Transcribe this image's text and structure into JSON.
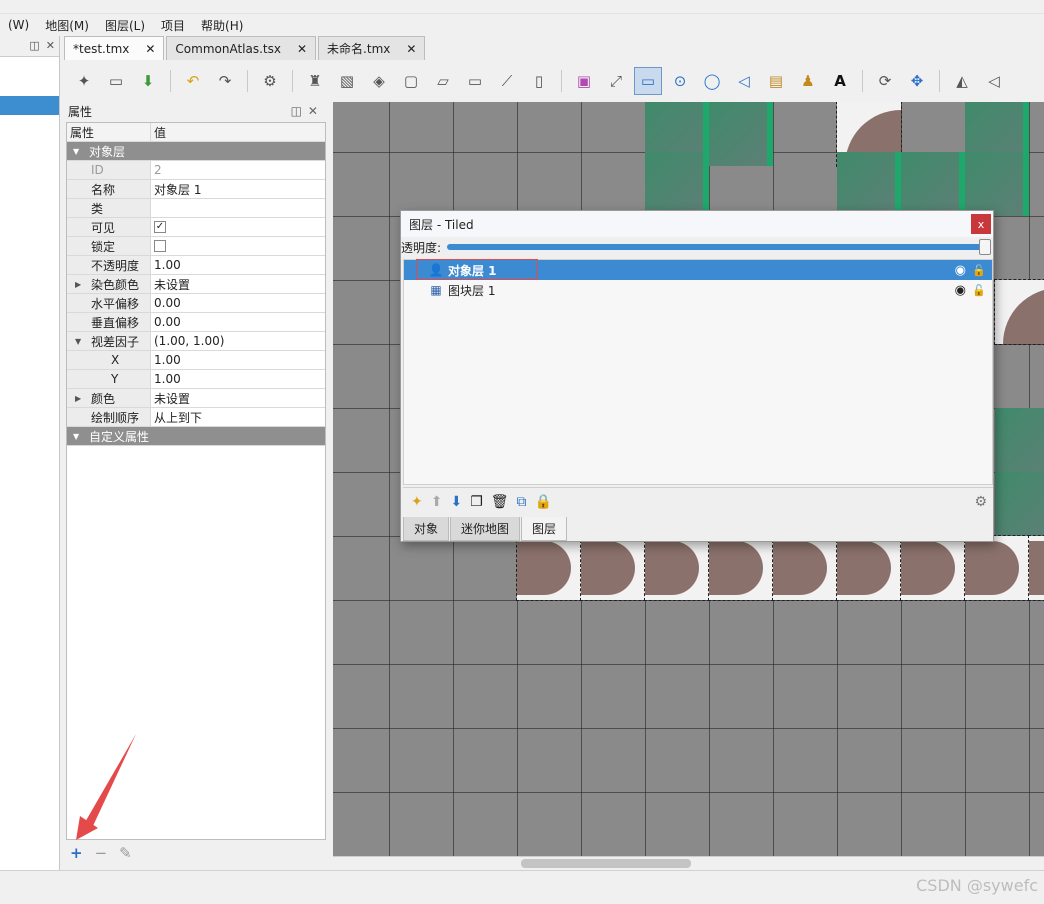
{
  "menu": {
    "items": [
      "(W)",
      "地图(M)",
      "图层(L)",
      "项目",
      "帮助(H)"
    ]
  },
  "tabs": [
    {
      "label": "*test.tmx",
      "close": "✕"
    },
    {
      "label": "CommonAtlas.tsx",
      "close": "✕"
    },
    {
      "label": "未命名.tmx",
      "close": "✕"
    }
  ],
  "properties_panel": {
    "title": "属性",
    "col_key": "属性",
    "col_value": "值",
    "group_object_layer": "对象层",
    "rows": [
      {
        "key": "ID",
        "value": "2"
      },
      {
        "key": "名称",
        "value": "对象层 1"
      },
      {
        "key": "类",
        "value": ""
      },
      {
        "key": "可见",
        "value": "✓"
      },
      {
        "key": "锁定",
        "value": ""
      },
      {
        "key": "不透明度",
        "value": "1.00"
      },
      {
        "key": "染色颜色",
        "value": "未设置"
      },
      {
        "key": "水平偏移",
        "value": "0.00"
      },
      {
        "key": "垂直偏移",
        "value": "0.00"
      },
      {
        "key": "视差因子",
        "value": "(1.00, 1.00)"
      },
      {
        "key": "X",
        "value": "1.00"
      },
      {
        "key": "Y",
        "value": "1.00"
      },
      {
        "key": "颜色",
        "value": "未设置"
      },
      {
        "key": "绘制顺序",
        "value": "从上到下"
      }
    ],
    "group_custom": "自定义属性",
    "footer": {
      "add": "+",
      "remove": "−",
      "edit": "✎"
    }
  },
  "layers_dialog": {
    "title": "图层 - Tiled",
    "close": "x",
    "opacity_label": "透明度:",
    "opacity_value": 1.0,
    "layers": [
      {
        "name": "对象层 1",
        "icon": "object-layer-icon",
        "selected": true
      },
      {
        "name": "图块层 1",
        "icon": "tile-layer-icon",
        "selected": false
      }
    ],
    "tabs": [
      "对象",
      "迷你地图",
      "图层"
    ],
    "active_tab": "图层"
  },
  "watermark": "CSDN @sywefc",
  "colors": {
    "selection": "#3b8ad2",
    "annotation": "#e54a4a",
    "tile_green": "#1fa86b",
    "tile_brown": "#8b716b"
  }
}
